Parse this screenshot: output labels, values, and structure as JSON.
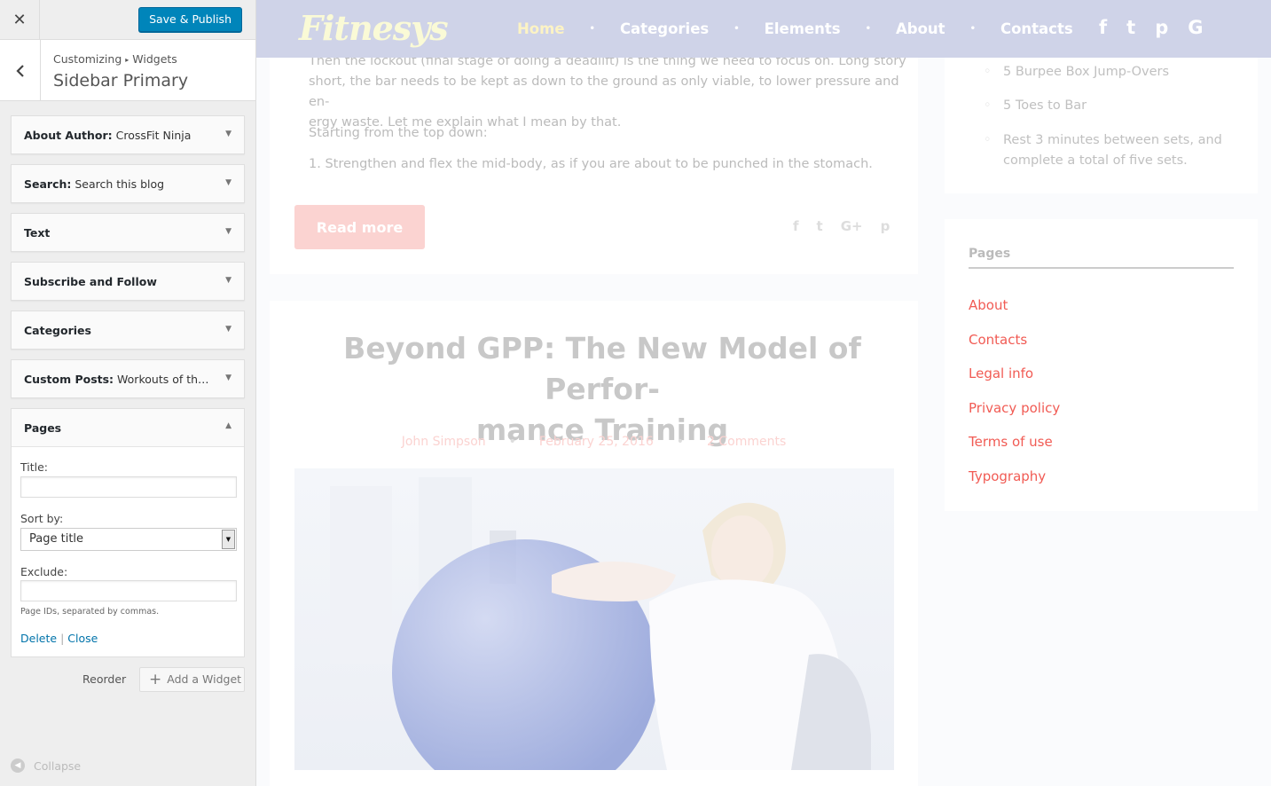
{
  "customizer": {
    "close_icon": "close-icon",
    "publish_label": "Save & Publish",
    "breadcrumb": {
      "part1": "Customizing",
      "sep": "▸",
      "part2": "Widgets"
    },
    "section_title": "Sidebar Primary",
    "widgets": [
      {
        "type": "About Author:",
        "instance": " CrossFit Ninja"
      },
      {
        "type": "Search:",
        "instance": " Search this blog"
      },
      {
        "type": "Text",
        "instance": ""
      },
      {
        "type": "Subscribe and Follow",
        "instance": ""
      },
      {
        "type": "Categories",
        "instance": ""
      },
      {
        "type": "Custom Posts:",
        "instance": " Workouts of the d..."
      }
    ],
    "open_widget": {
      "name": "Pages",
      "title_label": "Title:",
      "title_value": "",
      "sortby_label": "Sort by:",
      "sortby_value": "Page title",
      "exclude_label": "Exclude:",
      "exclude_value": "",
      "exclude_hint": "Page IDs, separated by commas.",
      "delete_label": "Delete",
      "sep": "|",
      "close_label": "Close"
    },
    "reorder_label": "Reorder",
    "add_widget_label": "Add a Widget",
    "collapse_label": "Collapse"
  },
  "site": {
    "logo": "Fitnesys",
    "menu": [
      "Home",
      "Categories",
      "Elements",
      "About",
      "Contacts"
    ],
    "menu_dot": "•",
    "social": [
      "f",
      "t",
      "p",
      "G"
    ],
    "post1": {
      "para1_line1": "Then the lockout (final stage of doing a deadlift) is the thing we need to focus on. Long story",
      "para1_line2": "short, the bar needs to be kept as down to the ground as only viable, to lower pressure and en-",
      "para1_line3": "ergy waste. Let me explain what I mean by that.",
      "para2": "Starting from the top down:",
      "para3": "1. Strengthen and flex the mid-body, as if you are about to be punched in the stomach.",
      "read_more": "Read more"
    },
    "share": [
      "f",
      "t",
      "G+",
      "p"
    ],
    "post2": {
      "title_line1": "Beyond GPP: The New Model of Perfor-",
      "title_line2": "mance Training",
      "author": "John Simpson",
      "date": "February 25, 2016",
      "comments": "2 Comments",
      "meta_dot": "•"
    },
    "workout_list": [
      "5 Burpee Box Jump-Overs",
      "5 Toes to Bar",
      "Rest 3 minutes between sets, and",
      "complete a total of five sets."
    ],
    "workout_bullet": "◦",
    "pages_widget": {
      "title": "Pages",
      "links": [
        "About",
        "Contacts",
        "Legal info",
        "Privacy policy",
        "Terms of use",
        "Typography"
      ]
    }
  },
  "colors": {
    "publish": "#0085ba",
    "accent_red": "#f15b54",
    "nav_bg": "#cfd3e8"
  }
}
